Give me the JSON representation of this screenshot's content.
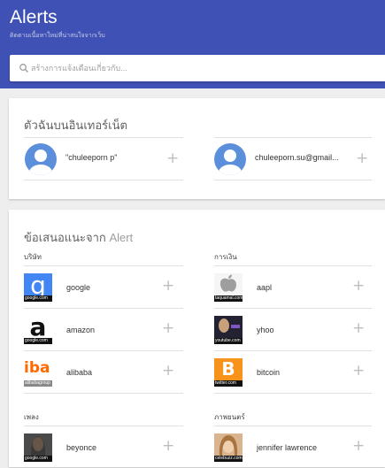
{
  "header": {
    "title": "Alerts",
    "subtitle": "ติดตามเนื้อหาใหม่ที่น่าสนใจจากเว็บ",
    "accent_color": "#3f51b5"
  },
  "search": {
    "placeholder": "สร้างการแจ้งเตือนเกี่ยวกับ...",
    "icon": "search-icon"
  },
  "me_card": {
    "title": "ตัวฉันบนอินเทอร์เน็ต",
    "accounts": [
      {
        "name": "\"chuleeporn p\"",
        "icon": "person-avatar"
      },
      {
        "name": "chuleeporn.su@gmail...",
        "icon": "person-avatar"
      }
    ]
  },
  "suggestions": {
    "title_prefix": "ข้อเสนอแนะจาก",
    "title_suffix": "Alert",
    "add_symbol": "+",
    "categories": [
      {
        "label": "บริษัท",
        "items": [
          {
            "name": "google",
            "caption": "google.com"
          },
          {
            "name": "amazon",
            "caption": "google.com"
          },
          {
            "name": "alibaba",
            "caption": "alibabagroup"
          }
        ]
      },
      {
        "label": "การเงิน",
        "items": [
          {
            "name": "aapl",
            "caption": "taquamal.com"
          },
          {
            "name": "yhoo",
            "caption": "youtube.com"
          },
          {
            "name": "bitcoin",
            "caption": "twitter.com"
          }
        ]
      },
      {
        "label": "เพลง",
        "items": [
          {
            "name": "beyonce",
            "caption": "google.com"
          }
        ]
      },
      {
        "label": "ภาพยนตร์",
        "items": [
          {
            "name": "jennifer lawrence",
            "caption": "celebuzz.com"
          }
        ]
      }
    ],
    "logo_text": {
      "google": "g",
      "amazon": "a",
      "alibaba": "iba",
      "bitcoin": "B"
    }
  }
}
